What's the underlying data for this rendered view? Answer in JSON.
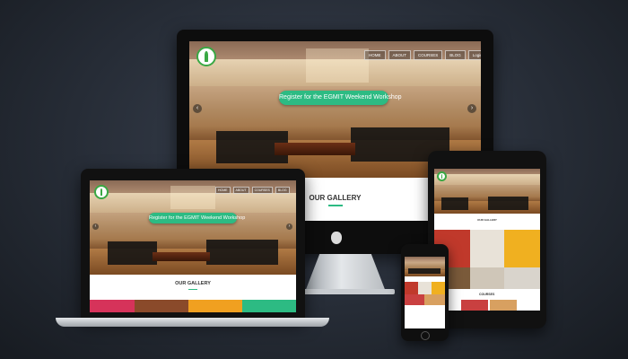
{
  "hero": {
    "cta": "Register for the EGMIT Weekend Workshop"
  },
  "nav": {
    "items": [
      "HOME",
      "ABOUT",
      "COURSES",
      "BLOG"
    ],
    "login": "Login | Register"
  },
  "gallery": {
    "title": "OUR GALLERY"
  },
  "tablet": {
    "section": "COURSES"
  },
  "colors": {
    "accent": "#2dbb83",
    "logo": "#3aa844"
  },
  "icons": [
    "apple-logo-icon",
    "chevron-left-icon",
    "chevron-right-icon",
    "home-icon",
    "user-icon"
  ]
}
